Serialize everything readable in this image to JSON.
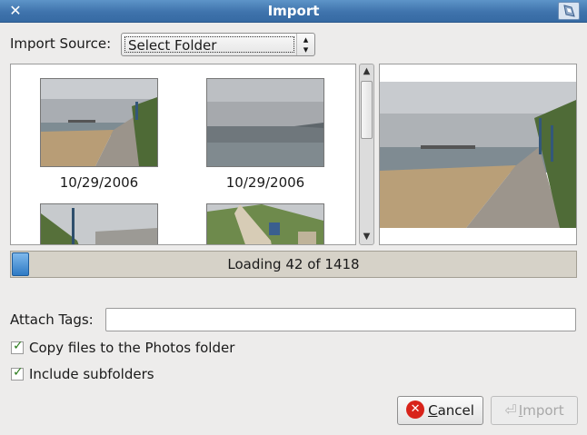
{
  "window": {
    "title": "Import",
    "close_glyph": "✕"
  },
  "import_source": {
    "label": "Import Source:",
    "selected": "Select Folder"
  },
  "thumbnails": [
    {
      "date": "10/29/2006",
      "scene": "beach-pier"
    },
    {
      "date": "10/29/2006",
      "scene": "sea-horizon"
    },
    {
      "date": "",
      "scene": "cliff-lamppost"
    },
    {
      "date": "",
      "scene": "cliff-stairs"
    }
  ],
  "progress": {
    "text": "Loading 42 of 1418",
    "fraction": 0.0296
  },
  "tags": {
    "label": "Attach Tags:",
    "value": ""
  },
  "options": {
    "copy_files": {
      "label": "Copy files to the Photos folder",
      "checked": true
    },
    "include_subfolders": {
      "label": "Include subfolders",
      "checked": true
    }
  },
  "buttons": {
    "cancel": {
      "mnemonic": "C",
      "rest": "ancel"
    },
    "import": {
      "mnemonic": "I",
      "rest": "mport",
      "enabled": false
    }
  },
  "icons": {
    "close": "close-icon",
    "app": "photos-app-icon",
    "combo": "updown-arrows-icon",
    "cancel": "cancel-icon",
    "import": "import-arrow-icon",
    "check": "checkmark-icon"
  },
  "colors": {
    "titlebar": "#3f73ac",
    "progress_fill": "#2e7ac4",
    "cancel_icon": "#d8231a"
  }
}
